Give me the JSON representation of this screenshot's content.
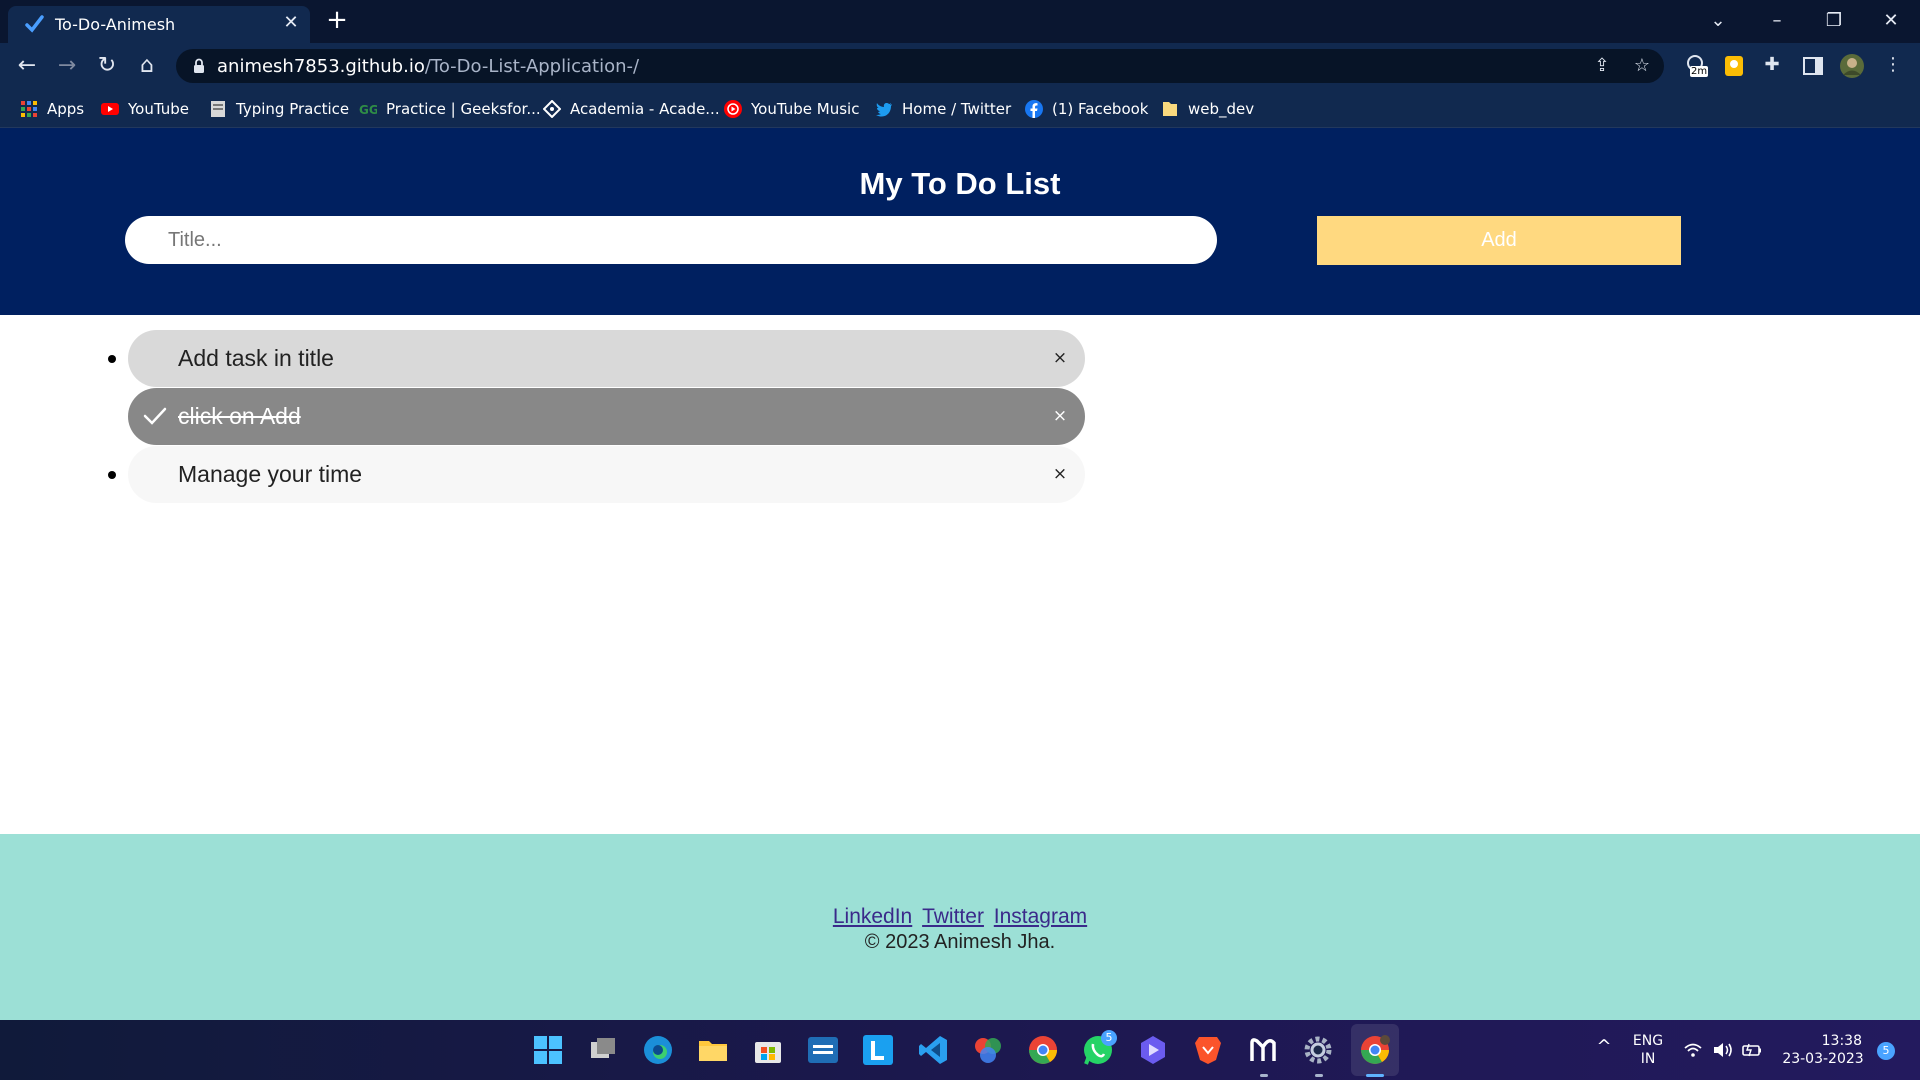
{
  "browser": {
    "tab_title": "To-Do-Animesh",
    "url_host": "animesh7853.github.io",
    "url_path": "/To-Do-List-Application-/",
    "extension_badge": "2m",
    "bookmarks": [
      {
        "label": "Apps",
        "icon": "apps-grid-icon"
      },
      {
        "label": "YouTube",
        "icon": "youtube-icon"
      },
      {
        "label": "Typing Practice",
        "icon": "typing-practice-icon"
      },
      {
        "label": "Practice | Geeksfor...",
        "icon": "geeksforgeeks-icon"
      },
      {
        "label": "Academia - Acade...",
        "icon": "academia-icon"
      },
      {
        "label": "YouTube Music",
        "icon": "youtube-music-icon"
      },
      {
        "label": "Home / Twitter",
        "icon": "twitter-icon"
      },
      {
        "label": "(1) Facebook",
        "icon": "facebook-icon"
      },
      {
        "label": "web_dev",
        "icon": "folder-icon"
      }
    ]
  },
  "todo": {
    "heading": "My To Do List",
    "input_placeholder": "Title...",
    "add_label": "Add",
    "tasks": [
      {
        "text": "Add task in title",
        "done": false
      },
      {
        "text": "click on Add",
        "done": true
      },
      {
        "text": "Manage your time",
        "done": false
      }
    ],
    "close_glyph": "×"
  },
  "footer": {
    "links": [
      "LinkedIn",
      "Twitter",
      "Instagram"
    ],
    "copyright": "© 2023 Animesh Jha."
  },
  "taskbar": {
    "whatsapp_badge": "5",
    "language": "ENG",
    "region": "IN",
    "time": "13:38",
    "date": "23-03-2023",
    "notification_count": "5"
  },
  "colors": {
    "header_bg": "#002060",
    "add_button": "#ffd980",
    "footer_bg": "#9ce0d6",
    "task_done_bg": "#888888",
    "task_bg": "#d9d9d9",
    "task_alt_bg": "#f7f7f7"
  }
}
